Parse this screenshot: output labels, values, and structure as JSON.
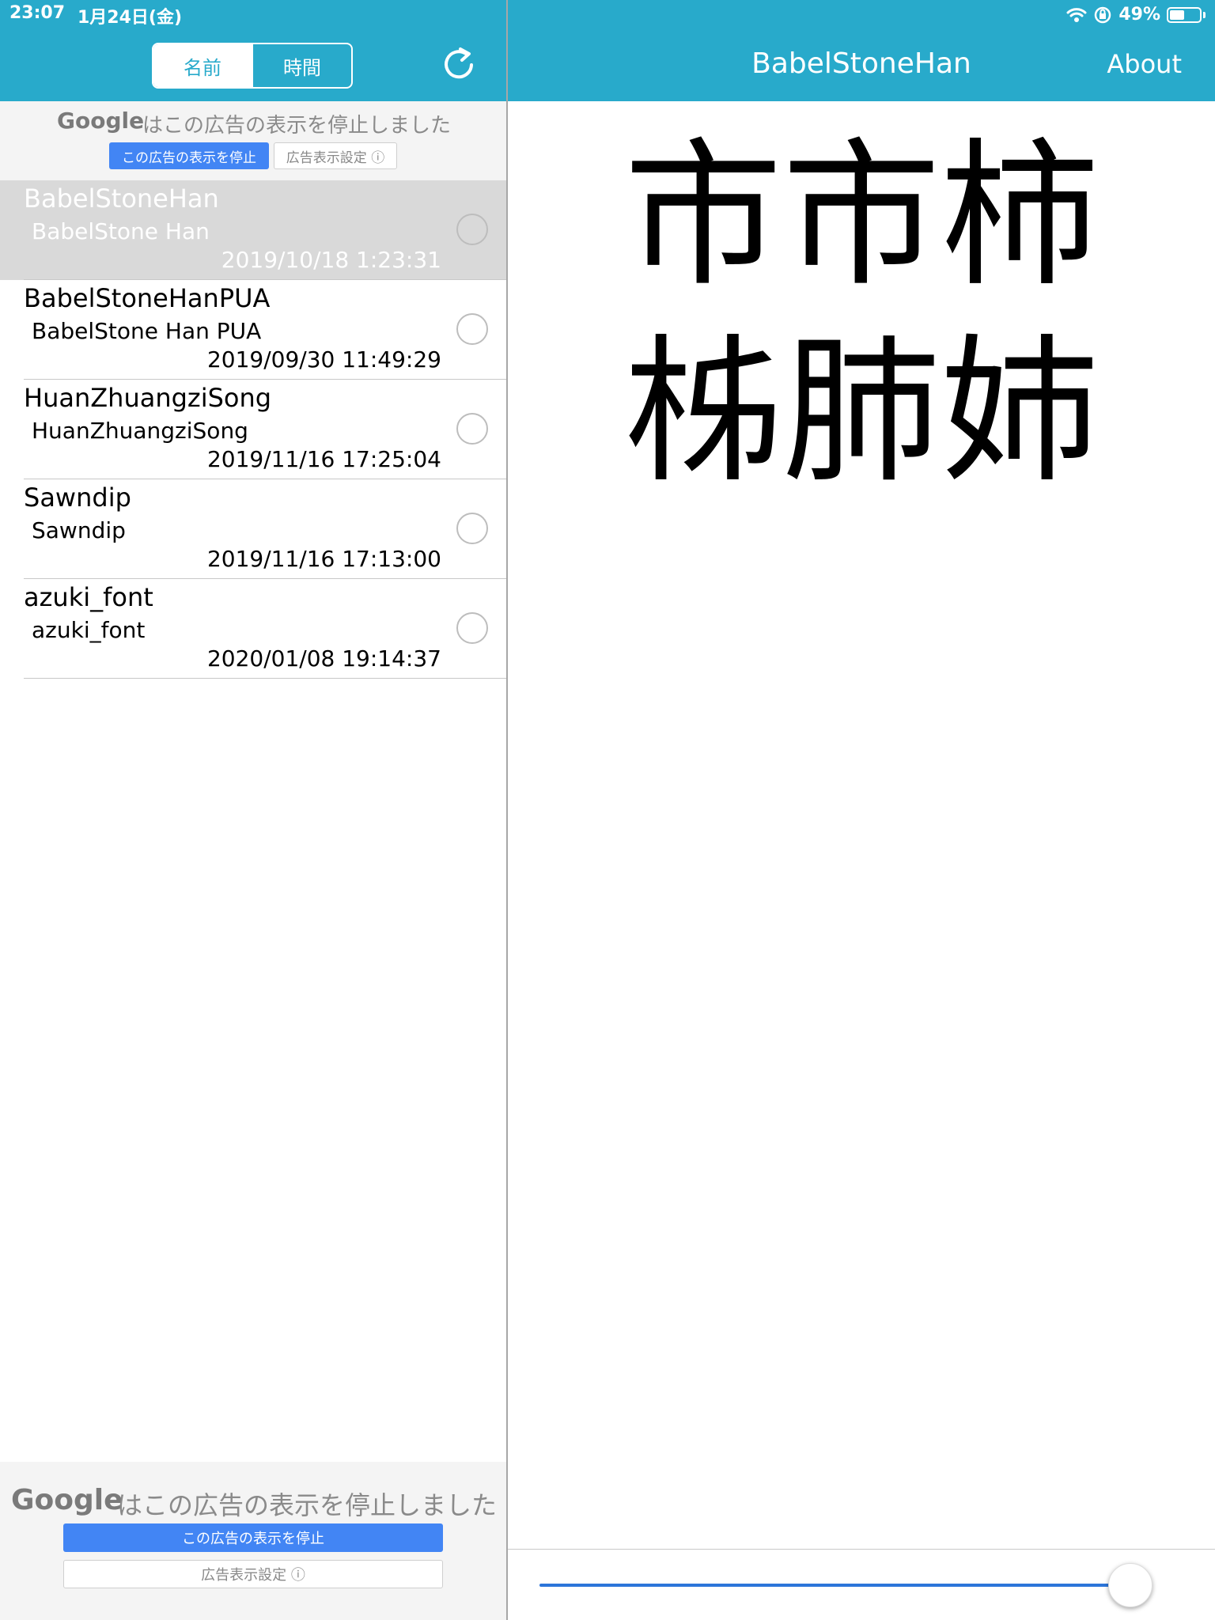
{
  "status": {
    "time": "23:07",
    "date": "1月24日(金)",
    "battery": "49%",
    "battery_level": 0.49
  },
  "left": {
    "segment": {
      "name_label": "名前",
      "time_label": "時間",
      "selected": "名前"
    },
    "ad_top": {
      "google": "Google",
      "message": "はこの広告の表示を停止しました",
      "stop_button": "この広告の表示を停止",
      "settings_button": "広告表示設定 ⓘ"
    },
    "fonts": [
      {
        "name": "BabelStoneHan",
        "family": "BabelStone Han",
        "date": "2019/10/18 1:23:31",
        "selected": true
      },
      {
        "name": "BabelStoneHanPUA",
        "family": "BabelStone Han PUA",
        "date": "2019/09/30 11:49:29",
        "selected": false
      },
      {
        "name": "HuanZhuangziSong",
        "family": "HuanZhuangziSong",
        "date": "2019/11/16 17:25:04",
        "selected": false
      },
      {
        "name": "Sawndip",
        "family": "Sawndip",
        "date": "2019/11/16 17:13:00",
        "selected": false
      },
      {
        "name": "azuki_font",
        "family": "azuki_font",
        "date": "2020/01/08 19:14:37",
        "selected": false
      }
    ],
    "ad_bottom": {
      "google": "Google",
      "message": "はこの広告の表示を停止しました",
      "stop_button": "この広告の表示を停止",
      "settings_button": "広告表示設定 ⓘ"
    }
  },
  "right": {
    "title": "BabelStoneHan",
    "about": "About",
    "preview_line1": "市市柿",
    "preview_line2": "柹肺姉",
    "slider_value": 0.97
  },
  "colors": {
    "header": "#28aacb",
    "ad_blue": "#4285f4",
    "slider": "#2c75d9",
    "selected_row": "#d9d9d9"
  }
}
